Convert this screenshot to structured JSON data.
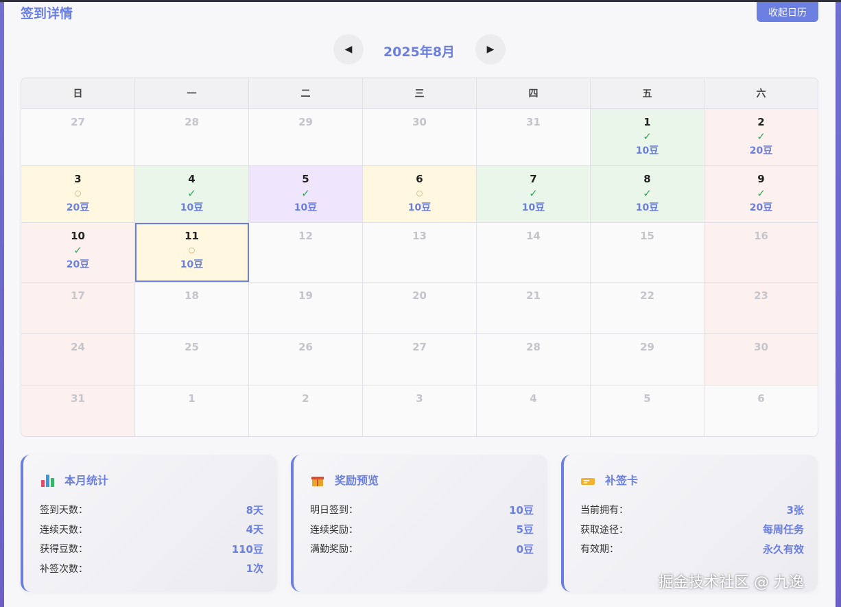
{
  "header": {
    "title": "签到详情",
    "collapse_label": "收起日历"
  },
  "nav": {
    "prev_icon": "◀",
    "next_icon": "▶",
    "month_label": "2025年8月"
  },
  "weekdays": [
    "日",
    "一",
    "二",
    "三",
    "四",
    "五",
    "六"
  ],
  "calendar": {
    "weeks": [
      [
        {
          "num": "27",
          "state": "other",
          "color": "plain",
          "mark": "",
          "beans": ""
        },
        {
          "num": "28",
          "state": "other",
          "color": "plain",
          "mark": "",
          "beans": ""
        },
        {
          "num": "29",
          "state": "other",
          "color": "plain",
          "mark": "",
          "beans": ""
        },
        {
          "num": "30",
          "state": "other",
          "color": "plain",
          "mark": "",
          "beans": ""
        },
        {
          "num": "31",
          "state": "other",
          "color": "plain",
          "mark": "",
          "beans": ""
        },
        {
          "num": "1",
          "state": "signed",
          "color": "green",
          "mark": "✓",
          "beans": "10豆"
        },
        {
          "num": "2",
          "state": "signed",
          "color": "pink",
          "mark": "✓",
          "beans": "20豆"
        }
      ],
      [
        {
          "num": "3",
          "state": "pending",
          "color": "yellow",
          "mark": "○",
          "beans": "20豆"
        },
        {
          "num": "4",
          "state": "signed",
          "color": "green",
          "mark": "✓",
          "beans": "10豆"
        },
        {
          "num": "5",
          "state": "signed",
          "color": "purple",
          "mark": "✓",
          "beans": "10豆"
        },
        {
          "num": "6",
          "state": "pending",
          "color": "yellow",
          "mark": "○",
          "beans": "10豆"
        },
        {
          "num": "7",
          "state": "signed",
          "color": "green",
          "mark": "✓",
          "beans": "10豆"
        },
        {
          "num": "8",
          "state": "signed",
          "color": "green",
          "mark": "✓",
          "beans": "10豆"
        },
        {
          "num": "9",
          "state": "signed",
          "color": "pink",
          "mark": "✓",
          "beans": "20豆"
        }
      ],
      [
        {
          "num": "10",
          "state": "signed",
          "color": "pink",
          "mark": "✓",
          "beans": "20豆"
        },
        {
          "num": "11",
          "state": "today",
          "color": "today",
          "mark": "○",
          "beans": "10豆"
        },
        {
          "num": "12",
          "state": "future",
          "color": "plain",
          "mark": "",
          "beans": ""
        },
        {
          "num": "13",
          "state": "future",
          "color": "plain",
          "mark": "",
          "beans": ""
        },
        {
          "num": "14",
          "state": "future",
          "color": "plain",
          "mark": "",
          "beans": ""
        },
        {
          "num": "15",
          "state": "future",
          "color": "plain",
          "mark": "",
          "beans": ""
        },
        {
          "num": "16",
          "state": "future",
          "color": "pink",
          "mark": "",
          "beans": ""
        }
      ],
      [
        {
          "num": "17",
          "state": "future",
          "color": "pink",
          "mark": "",
          "beans": ""
        },
        {
          "num": "18",
          "state": "future",
          "color": "plain",
          "mark": "",
          "beans": ""
        },
        {
          "num": "19",
          "state": "future",
          "color": "plain",
          "mark": "",
          "beans": ""
        },
        {
          "num": "20",
          "state": "future",
          "color": "plain",
          "mark": "",
          "beans": ""
        },
        {
          "num": "21",
          "state": "future",
          "color": "plain",
          "mark": "",
          "beans": ""
        },
        {
          "num": "22",
          "state": "future",
          "color": "plain",
          "mark": "",
          "beans": ""
        },
        {
          "num": "23",
          "state": "future",
          "color": "pink",
          "mark": "",
          "beans": ""
        }
      ],
      [
        {
          "num": "24",
          "state": "future",
          "color": "pink",
          "mark": "",
          "beans": ""
        },
        {
          "num": "25",
          "state": "future",
          "color": "plain",
          "mark": "",
          "beans": ""
        },
        {
          "num": "26",
          "state": "future",
          "color": "plain",
          "mark": "",
          "beans": ""
        },
        {
          "num": "27",
          "state": "future",
          "color": "plain",
          "mark": "",
          "beans": ""
        },
        {
          "num": "28",
          "state": "future",
          "color": "plain",
          "mark": "",
          "beans": ""
        },
        {
          "num": "29",
          "state": "future",
          "color": "plain",
          "mark": "",
          "beans": ""
        },
        {
          "num": "30",
          "state": "future",
          "color": "pink",
          "mark": "",
          "beans": ""
        }
      ],
      [
        {
          "num": "31",
          "state": "future",
          "color": "pink",
          "mark": "",
          "beans": ""
        },
        {
          "num": "1",
          "state": "other",
          "color": "plain",
          "mark": "",
          "beans": ""
        },
        {
          "num": "2",
          "state": "other",
          "color": "plain",
          "mark": "",
          "beans": ""
        },
        {
          "num": "3",
          "state": "other",
          "color": "plain",
          "mark": "",
          "beans": ""
        },
        {
          "num": "4",
          "state": "other",
          "color": "plain",
          "mark": "",
          "beans": ""
        },
        {
          "num": "5",
          "state": "other",
          "color": "plain",
          "mark": "",
          "beans": ""
        },
        {
          "num": "6",
          "state": "other",
          "color": "plain",
          "mark": "",
          "beans": ""
        }
      ]
    ]
  },
  "stats": [
    {
      "title": "本月统计",
      "icon": "bar-chart-icon",
      "rows": [
        {
          "k": "签到天数：",
          "v": "8天"
        },
        {
          "k": "连续天数：",
          "v": "4天"
        },
        {
          "k": "获得豆数：",
          "v": "110豆"
        },
        {
          "k": "补签次数：",
          "v": "1次"
        }
      ]
    },
    {
      "title": "奖励预览",
      "icon": "gift-icon",
      "rows": [
        {
          "k": "明日签到：",
          "v": "10豆"
        },
        {
          "k": "连续奖励：",
          "v": "5豆"
        },
        {
          "k": "满勤奖励：",
          "v": "0豆"
        }
      ]
    },
    {
      "title": "补签卡",
      "icon": "ticket-icon",
      "rows": [
        {
          "k": "当前拥有：",
          "v": "3张"
        },
        {
          "k": "获取途径：",
          "v": "每周任务"
        },
        {
          "k": "有效期：",
          "v": "永久有效"
        }
      ]
    }
  ],
  "watermark": "掘金技术社区 @ 九逸",
  "colors": {
    "accent": "#6b7fe0",
    "check": "#3aa35a"
  }
}
